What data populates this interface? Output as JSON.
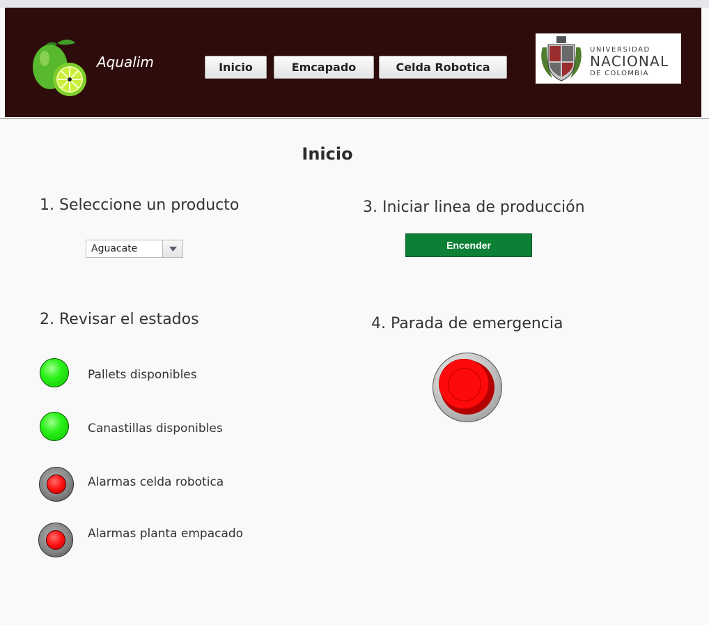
{
  "header": {
    "brand": "Aqualim",
    "nav": [
      "Inicio",
      "Emcapado",
      "Celda Robotica"
    ],
    "university": {
      "line1": "UNIVERSIDAD",
      "line2": "NACIONAL",
      "line3": "DE COLOMBIA"
    }
  },
  "page": {
    "title": "Inicio"
  },
  "step1": {
    "heading": "1. Seleccione un producto",
    "selected": "Aguacate"
  },
  "step2": {
    "heading": "2. Revisar el estados",
    "indicators": [
      {
        "label": "Pallets disponibles",
        "status": "green"
      },
      {
        "label": "Canastillas disponibles",
        "status": "green"
      },
      {
        "label": "Alarmas celda robotica",
        "status": "red"
      },
      {
        "label": "Alarmas planta empacado",
        "status": "red"
      }
    ]
  },
  "step3": {
    "heading": "3. Iniciar linea de producción",
    "button": "Encender"
  },
  "step4": {
    "heading": "4. Parada de emergencia"
  },
  "colors": {
    "header_bg": "#2e0c0b",
    "start_green": "#0c8035",
    "led_green": "#2bf21a",
    "alarm_red": "#ff1010"
  },
  "icons": {
    "logo": "lime-icon",
    "select_arrow": "chevron-down-icon",
    "emergency": "emergency-stop-icon"
  }
}
